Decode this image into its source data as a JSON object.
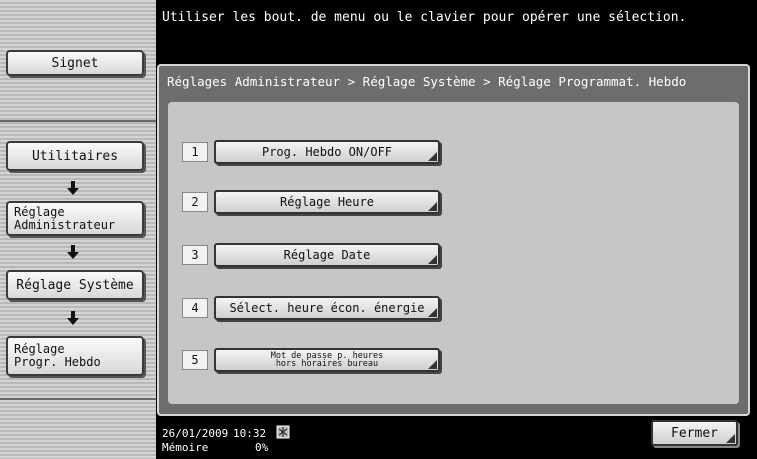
{
  "top_message": "Utiliser les bout. de menu ou le clavier pour opérer une sélection.",
  "sidebar": {
    "bookmark_label": "Signet",
    "steps": [
      {
        "label": "Utilitaires"
      },
      {
        "label": "Réglage\nAdministrateur"
      },
      {
        "label": "Réglage Système"
      },
      {
        "label": "Réglage\nProgr. Hebdo"
      }
    ]
  },
  "breadcrumb": "Réglages Administrateur > Réglage Système > Réglage Programmat. Hebdo",
  "options": [
    {
      "number": "1",
      "label": "Prog. Hebdo ON/OFF"
    },
    {
      "number": "2",
      "label": "Réglage Heure"
    },
    {
      "number": "3",
      "label": "Réglage Date"
    },
    {
      "number": "4",
      "label": "Sélect. heure écon. énergie"
    },
    {
      "number": "5",
      "label": "Mot de passe p. heures\nhors horaires bureau"
    }
  ],
  "footer": {
    "date": "26/01/2009",
    "time": "10:32",
    "memory_label": "Mémoire",
    "memory_value": "0%",
    "close_label": "Fermer"
  }
}
